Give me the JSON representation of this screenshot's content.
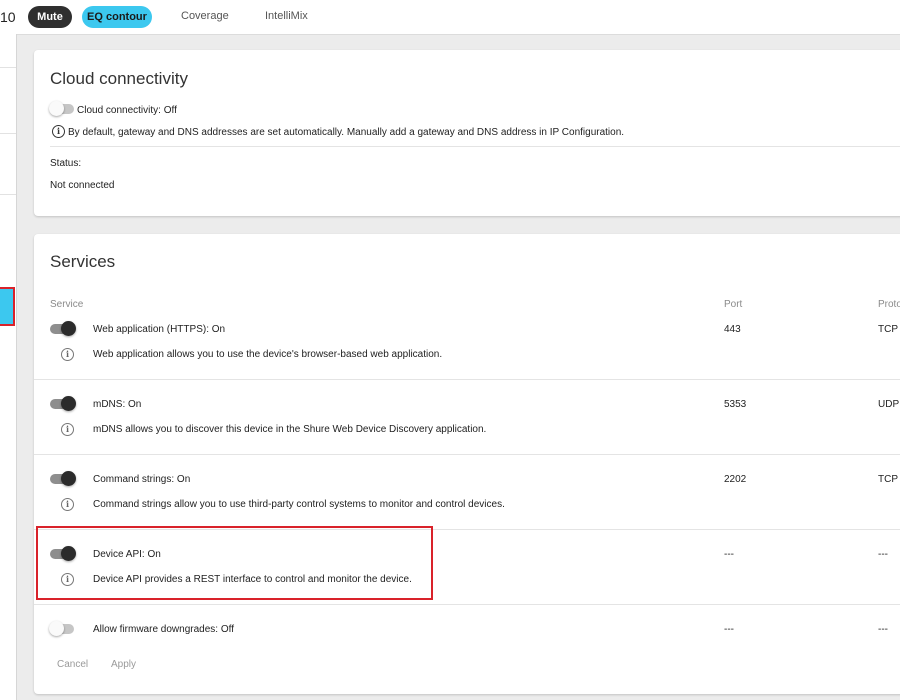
{
  "topbar": {
    "cut_text": "10",
    "mute_label": "Mute",
    "eq_label": "EQ contour",
    "tabs": [
      "Coverage",
      "IntelliMix"
    ]
  },
  "cloud": {
    "title": "Cloud connectivity",
    "toggle_label": "Cloud connectivity: Off",
    "info": "By default, gateway and DNS addresses are set automatically. Manually add a gateway and DNS address in IP Configuration.",
    "status_label": "Status:",
    "status_value": "Not connected"
  },
  "services": {
    "title": "Services",
    "headers": {
      "service": "Service",
      "port": "Port",
      "protocol": "Proto"
    },
    "rows": [
      {
        "label": "Web application (HTTPS): On",
        "desc": "Web application allows you to use the device's browser-based web application.",
        "port": "443",
        "protocol": "TCP",
        "state": "on"
      },
      {
        "label": "mDNS: On",
        "desc": "mDNS allows you to discover this device in the Shure Web Device Discovery application.",
        "port": "5353",
        "protocol": "UDP",
        "state": "on"
      },
      {
        "label": "Command strings: On",
        "desc": "Command strings allow you to use third-party control systems to monitor and control devices.",
        "port": "2202",
        "protocol": "TCP",
        "state": "on"
      },
      {
        "label": "Device API: On",
        "desc": "Device API provides a REST interface to control and monitor the device.",
        "port": "---",
        "protocol": "---",
        "state": "on"
      },
      {
        "label": "Allow firmware downgrades: Off",
        "port": "---",
        "protocol": "---",
        "state": "off"
      }
    ],
    "cancel_label": "Cancel",
    "apply_label": "Apply"
  },
  "colors": {
    "accent": "#3cc8ef",
    "highlight": "#d9222a",
    "pill_dark": "#2f2f2f"
  }
}
